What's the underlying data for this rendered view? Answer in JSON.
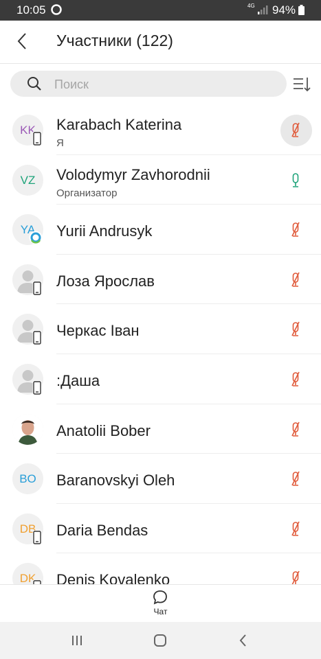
{
  "status": {
    "time": "10:05",
    "network": "4G",
    "battery": "94%"
  },
  "header": {
    "title": "Участники (122)"
  },
  "search": {
    "placeholder": "Поиск"
  },
  "participants": [
    {
      "initials": "KK",
      "initials_color": "#9b59b6",
      "name": "Karabach Katerina",
      "subtitle": "Я",
      "device": "phone",
      "mic": "muted",
      "highlight": true
    },
    {
      "initials": "VZ",
      "initials_color": "#1fa37a",
      "name": "Volodymyr Zavhorodnii",
      "subtitle": "Организатор",
      "device": "",
      "mic": "on"
    },
    {
      "initials": "YA",
      "initials_color": "#2a9fd8",
      "name": "Yurii Andrusyk",
      "subtitle": "",
      "device": "app",
      "mic": "muted"
    },
    {
      "initials": "",
      "initials_color": "",
      "name": " Лоза Ярослав",
      "subtitle": "",
      "device": "phone",
      "mic": "muted",
      "avatar": "placeholder"
    },
    {
      "initials": "",
      "initials_color": "",
      "name": " Черкас Іван",
      "subtitle": "",
      "device": "phone",
      "mic": "muted",
      "avatar": "placeholder"
    },
    {
      "initials": "",
      "initials_color": "",
      "name": ":Даша",
      "subtitle": "",
      "device": "phone",
      "mic": "muted",
      "avatar": "placeholder"
    },
    {
      "initials": "",
      "initials_color": "",
      "name": "Anatolii Bober",
      "subtitle": "",
      "device": "",
      "mic": "muted",
      "avatar": "photo"
    },
    {
      "initials": "BO",
      "initials_color": "#2a9fd8",
      "name": "Baranovskyi Oleh",
      "subtitle": "",
      "device": "",
      "mic": "muted"
    },
    {
      "initials": "DB",
      "initials_color": "#f0a030",
      "name": "Daria Bendas",
      "subtitle": "",
      "device": "phone",
      "mic": "muted"
    },
    {
      "initials": "DK",
      "initials_color": "#f0a030",
      "name": "Denis Kovalenko",
      "subtitle": "",
      "device": "phone",
      "mic": "muted"
    }
  ],
  "bottom": {
    "chat_label": "Чат"
  },
  "colors": {
    "mic_muted": "#e05a3a",
    "mic_on": "#1fa37a",
    "statusbar": "#3a3a3a"
  }
}
